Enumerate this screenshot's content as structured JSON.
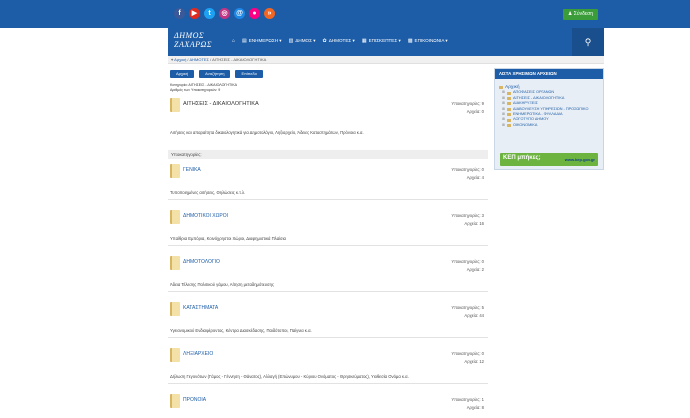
{
  "topbar": {
    "social": [
      {
        "name": "facebook-icon",
        "glyph": "f",
        "color": "#3b5998"
      },
      {
        "name": "youtube-icon",
        "glyph": "▶",
        "color": "#e02a20"
      },
      {
        "name": "twitter-icon",
        "glyph": "t",
        "color": "#1da1f2"
      },
      {
        "name": "instagram-icon",
        "glyph": "◎",
        "color": "#c13584"
      },
      {
        "name": "email-icon",
        "glyph": "@",
        "color": "#1e88e5"
      },
      {
        "name": "flickr-icon",
        "glyph": "●",
        "color": "#ff0084"
      },
      {
        "name": "rss-icon",
        "glyph": "»",
        "color": "#f26522"
      }
    ],
    "login_label": "Σύνδεση"
  },
  "logo": {
    "line1": "ΔΗΜΟΣ",
    "line2": "ΖΑΧΑΡΩΣ"
  },
  "nav": [
    {
      "icon": "⌂",
      "label": ""
    },
    {
      "icon": "▤",
      "label": "ΕΝΗΜΕΡΩΣΗ ▾"
    },
    {
      "icon": "▥",
      "label": "ΔΗΜΟΣ ▾"
    },
    {
      "icon": "✿",
      "label": "ΔΗΜΟΤΕΣ ▾"
    },
    {
      "icon": "▦",
      "label": "ΕΠΙΣΚΕΠΤΕΣ ▾"
    },
    {
      "icon": "▩",
      "label": "ΕΠΙΚΟΙΝΩΝΙΑ ▾"
    }
  ],
  "breadcrumb": {
    "home": "Αρχική",
    "sep": " / ",
    "level1": "ΔΗΜΟΤΕΣ",
    "level2": "ΑΙΤΗΣΕΙΣ - ΔΙΚΑΙΟΛΟΓΗΤΙΚΑ"
  },
  "buttons": {
    "home": "Αρχική",
    "search": "Αναζήτηση",
    "upload": "Επίπεδο"
  },
  "meta": {
    "line1": "Κατηγορία: ΑΙΤΗΣΕΙΣ - ΔΙΚΑΙΟΛΟΓΗΤΙΚΑ",
    "line2": "Αριθμός των Υποκατηγοριών: 9"
  },
  "main_category": {
    "title": "ΑΙΤΗΣΕΙΣ - ΔΙΚΑΙΟΛΟΓΗΤΙΚΑ",
    "subcats": "Υποκατηγορίες: 9",
    "files": "Αρχεία: 0",
    "desc": "Αιτήσεις και απαραίτητα δικαιολογητικά για Δημοτολόγιο, Ληξιαρχείο, Άδειες Καταστημάτων, Πρόνοια κ.α."
  },
  "subcat_header": "Υποκατηγορίες:",
  "categories": [
    {
      "title": "ΓΕΝΙΚΑ",
      "subcats": "Υποκατηγορίες: 0",
      "files": "Αρχεία: 4",
      "desc": "Τυποποιημένες αιτήσεις, Θηλώσεις κ.τ.λ."
    },
    {
      "title": "ΔΗΜΟΤΙΚΟΙ ΧΩΡΟΙ",
      "subcats": "Υποκατηγορίες: 3",
      "files": "Αρχεία: 16",
      "desc": "Υπαίθρια Εμπόρια, Κοινόχρηστοι Χώροι, Διαφημιστικά Πλαίσια"
    },
    {
      "title": "ΔΗΜΟΤΟΛΟΓΙΟ",
      "subcats": "Υποκατηγορίες: 0",
      "files": "Αρχεία: 2",
      "desc": "Άδεια Τέλεσης Πολιτικού γάμου, Αίτηση μεταδημότευσης"
    },
    {
      "title": "ΚΑΤΑΣΤΗΜΑΤΑ",
      "subcats": "Υποκατηγορίες: 5",
      "files": "Αρχεία: 44",
      "desc": "Υγειονομικού Ενδιαφέροντος, Κέντρα Διασκέδασης, Παιδότοποι, Παίγνια κ.α."
    },
    {
      "title": "ΛΗΞΙΑΡΧΕΙΟ",
      "subcats": "Υποκατηγορίες: 0",
      "files": "Αρχεία: 12",
      "desc": "Δήλωση Γεγονότων (Γάμος - Γέννηση - Θάνατος), Αλλαγή (Επώνυμου - Κύριου Ονόματος - Θρησκεύματος), Υιοθεσία Ονόμα κ.α."
    },
    {
      "title": "ΠΡΟΝΟΙΑ",
      "subcats": "Υποκατηγορίες: 1",
      "files": "Αρχεία: 8",
      "desc": ""
    }
  ],
  "sidebar": {
    "title": "ΛΙΣΤΑ ΧΡΗΣΙΜΩΝ ΑΡΧΕΙΩΝ",
    "root": "Αρχική",
    "items": [
      "ΑΠΟΦΑΣΕΙΣ ΟΡΓΑΝΩΝ",
      "ΑΙΤΗΣΕΙΣ - ΔΙΚΑΙΟΛΟΓΗΤΙΚΑ",
      "ΔΙΑΚΗΡΥΞΕΙΣ",
      "ΔΙΑΒΟΥΛΕΥΣΗ ΥΠΗΡΕΣΙΩΝ - ΠΡΟΣΩΠΙΚΟ",
      "ΕΝΗΜΕΡΩΤΙΚΑ - ΦΥΛΛΑΔΙΑ",
      "ΛΟΓΟΤΥΠΟ ΔΗΜΟΥ",
      "ΟΙΚΟΝΟΜΙΚΑ"
    ],
    "kep_left": "ΚΕΠ μπήκες;",
    "kep_right": "www.kep.gov.gr"
  }
}
